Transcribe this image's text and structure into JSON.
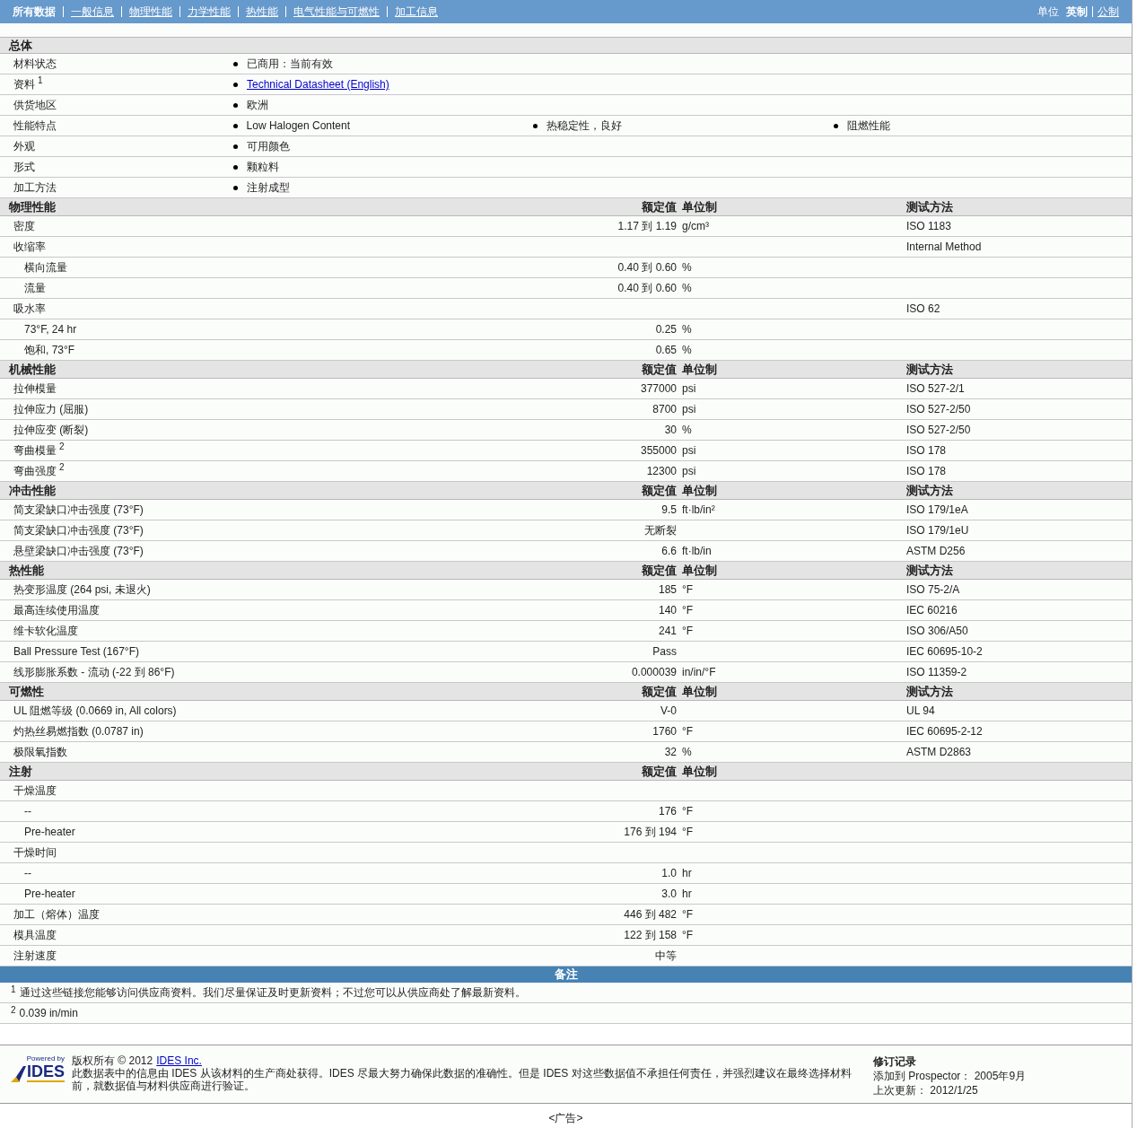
{
  "nav": {
    "items": [
      {
        "label": "所有数据",
        "selected": true
      },
      {
        "label": "一般信息",
        "selected": false
      },
      {
        "label": "物理性能",
        "selected": false
      },
      {
        "label": "力学性能",
        "selected": false
      },
      {
        "label": "热性能",
        "selected": false
      },
      {
        "label": "电气性能与可燃性",
        "selected": false
      },
      {
        "label": "加工信息",
        "selected": false
      }
    ],
    "units_label": "单位",
    "units": [
      {
        "label": "英制",
        "selected": true
      },
      {
        "label": "公制",
        "selected": false
      }
    ]
  },
  "sections": [
    {
      "kind": "general",
      "title": "总体",
      "rows": [
        {
          "name": "材料状态",
          "kind": "text",
          "values": [
            "已商用：当前有效"
          ]
        },
        {
          "name": "资料",
          "sup": "1",
          "kind": "link",
          "values": [
            "Technical Datasheet (English)"
          ]
        },
        {
          "name": "供货地区",
          "kind": "text",
          "values": [
            "欧洲"
          ]
        },
        {
          "name": "性能特点",
          "kind": "text",
          "values": [
            "Low Halogen Content",
            "热稳定性，良好",
            "阻燃性能"
          ]
        },
        {
          "name": "外观",
          "kind": "text",
          "values": [
            "可用颜色"
          ]
        },
        {
          "name": "形式",
          "kind": "text",
          "values": [
            "颗粒料"
          ]
        },
        {
          "name": "加工方法",
          "kind": "text",
          "values": [
            "注射成型"
          ]
        }
      ]
    },
    {
      "kind": "property",
      "title": "物理性能",
      "columns": [
        "额定值",
        "单位制",
        "测试方法"
      ],
      "rows": [
        {
          "name": "密度",
          "value": "1.17 到 1.19",
          "unit": "g/cm³",
          "method": "ISO 1183"
        },
        {
          "name": "收缩率",
          "method": "Internal Method",
          "children": [
            {
              "name": "横向流量",
              "value": "0.40 到 0.60",
              "unit": "%"
            },
            {
              "name": "流量",
              "value": "0.40 到 0.60",
              "unit": "%"
            }
          ]
        },
        {
          "name": "吸水率",
          "method": "ISO 62",
          "children": [
            {
              "name": "73°F, 24 hr",
              "value": "0.25",
              "unit": "%"
            },
            {
              "name": "饱和, 73°F",
              "value": "0.65",
              "unit": "%"
            }
          ]
        }
      ]
    },
    {
      "kind": "property",
      "title": "机械性能",
      "columns": [
        "额定值",
        "单位制",
        "测试方法"
      ],
      "rows": [
        {
          "name": "拉伸模量",
          "value": "377000",
          "unit": "psi",
          "method": "ISO 527-2/1"
        },
        {
          "name": "拉伸应力 (屈服)",
          "value": "8700",
          "unit": "psi",
          "method": "ISO 527-2/50"
        },
        {
          "name": "拉伸应变 (断裂)",
          "value": "30",
          "unit": "%",
          "method": "ISO 527-2/50"
        },
        {
          "name": "弯曲模量",
          "sup": "2",
          "value": "355000",
          "unit": "psi",
          "method": "ISO 178"
        },
        {
          "name": "弯曲强度",
          "sup": "2",
          "value": "12300",
          "unit": "psi",
          "method": "ISO 178"
        }
      ]
    },
    {
      "kind": "property",
      "title": "冲击性能",
      "columns": [
        "额定值",
        "单位制",
        "测试方法"
      ],
      "rows": [
        {
          "name": "简支梁缺口冲击强度 (73°F)",
          "value": "9.5",
          "unit": "ft·lb/in²",
          "method": "ISO 179/1eA"
        },
        {
          "name": "简支梁缺口冲击强度 (73°F)",
          "value": "无断裂",
          "method": "ISO 179/1eU"
        },
        {
          "name": "悬壁梁缺口冲击强度 (73°F)",
          "value": "6.6",
          "unit": "ft·lb/in",
          "method": "ASTM D256"
        }
      ]
    },
    {
      "kind": "property",
      "title": "热性能",
      "columns": [
        "额定值",
        "单位制",
        "测试方法"
      ],
      "rows": [
        {
          "name": "热变形温度 (264 psi, 未退火)",
          "value": "185",
          "unit": "°F",
          "method": "ISO 75-2/A"
        },
        {
          "name": "最高连续使用温度",
          "value": "140",
          "unit": "°F",
          "method": "IEC 60216"
        },
        {
          "name": "维卡软化温度",
          "value": "241",
          "unit": "°F",
          "method": "ISO 306/A50"
        },
        {
          "name": "Ball Pressure Test (167°F)",
          "value": "Pass",
          "method": "IEC 60695-10-2"
        },
        {
          "name": "线形膨胀系数 - 流动 (-22 到 86°F)",
          "value": "0.000039",
          "unit": "in/in/°F",
          "method": "ISO 11359-2"
        }
      ]
    },
    {
      "kind": "property",
      "title": "可燃性",
      "columns": [
        "额定值",
        "单位制",
        "测试方法"
      ],
      "rows": [
        {
          "name": "UL 阻燃等级 (0.0669 in, All colors)",
          "value": "V-0",
          "method": "UL 94"
        },
        {
          "name": "灼热丝易燃指数 (0.0787 in)",
          "value": "1760",
          "unit": "°F",
          "method": "IEC 60695-2-12"
        },
        {
          "name": "极限氧指数",
          "value": "32",
          "unit": "%",
          "method": "ASTM D2863"
        }
      ]
    },
    {
      "kind": "property",
      "title": "注射",
      "columns": [
        "额定值",
        "单位制"
      ],
      "rows": [
        {
          "name": "干燥温度",
          "children": [
            {
              "name": "--",
              "value": "176",
              "unit": "°F"
            },
            {
              "name": "Pre-heater",
              "value": "176 到 194",
              "unit": "°F"
            }
          ]
        },
        {
          "name": "干燥时间",
          "children": [
            {
              "name": "--",
              "value": "1.0",
              "unit": "hr"
            },
            {
              "name": "Pre-heater",
              "value": "3.0",
              "unit": "hr"
            }
          ]
        },
        {
          "name": "加工（熔体）温度",
          "value": "446 到 482",
          "unit": "°F"
        },
        {
          "name": "模具温度",
          "value": "122 到 158",
          "unit": "°F"
        },
        {
          "name": "注射速度",
          "value": "中等"
        }
      ]
    }
  ],
  "notes": {
    "title": "备注",
    "items": [
      {
        "sup": "1",
        "text": "通过这些链接您能够访问供应商资料。我们尽量保证及时更新资料；不过您可以从供应商处了解最新资料。"
      },
      {
        "sup": "2",
        "text": "0.039 in/min"
      }
    ]
  },
  "footer": {
    "logo_small": "Powered by",
    "logo": "IDES",
    "copyright": "版权所有 © 2012",
    "company_link": "IDES Inc.",
    "disclaimer": "此数据表中的信息由 IDES 从该材料的生产商处获得。IDES 尽最大努力确保此数据的准确性。但是 IDES 对这些数据值不承担任何责任，并强烈建议在最终选择材料前，就数据值与材料供应商进行验证。",
    "revision_title": "修订记录",
    "revision_lines": [
      "添加到 Prospector： 2005年9月",
      "上次更新： 2012/1/25"
    ]
  },
  "ad": "<广告>"
}
